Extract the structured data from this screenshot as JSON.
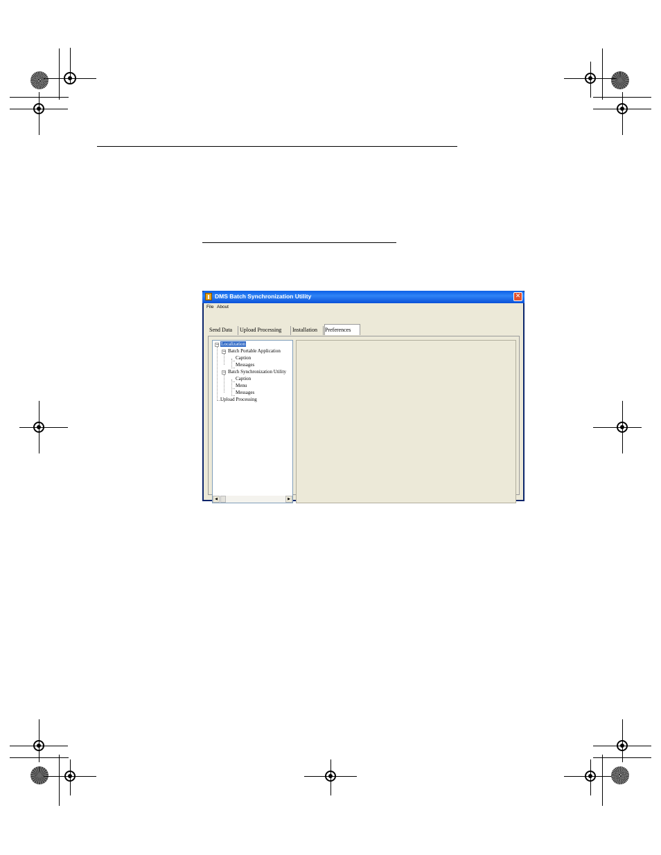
{
  "window": {
    "title": "DMS Batch Synchronization Utility",
    "close_glyph": "✕"
  },
  "menu": [
    "File",
    "About"
  ],
  "tabs": [
    {
      "label": "Send Data"
    },
    {
      "label": "Upload Processing"
    },
    {
      "label": "Installation"
    },
    {
      "label": "Preferences",
      "active": true
    }
  ],
  "tree": {
    "items": [
      {
        "label": "Localization",
        "selected": true
      },
      {
        "label": "Batch Portable Application"
      },
      {
        "label": "Caption"
      },
      {
        "label": "Messages"
      },
      {
        "label": "Batch Synchronization Utility"
      },
      {
        "label": "Caption"
      },
      {
        "label": "Menu"
      },
      {
        "label": "Messages"
      },
      {
        "label": "Upload Processing"
      }
    ],
    "expander_glyph": "−"
  },
  "scroll": {
    "left_glyph": "◀",
    "right_glyph": "▶"
  },
  "colors": {
    "titlebar": "#0b5fe6",
    "client": "#ece9d8",
    "selection": "#316ac5"
  }
}
